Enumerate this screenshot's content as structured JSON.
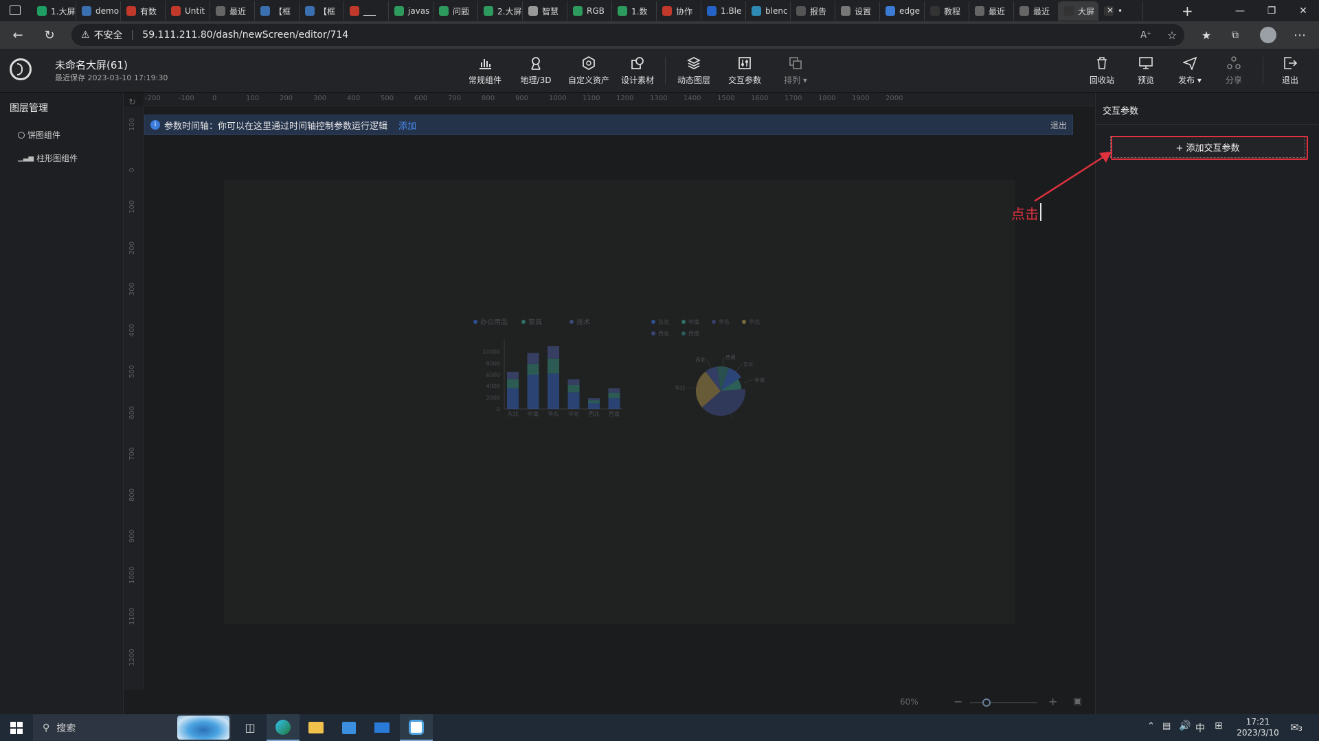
{
  "browser": {
    "tabs": [
      {
        "label": "1.大屏",
        "color": "#1e9e63"
      },
      {
        "label": "demo",
        "color": "#3a6fb0"
      },
      {
        "label": "有数",
        "color": "#c0392b"
      },
      {
        "label": "Untit",
        "color": "#c0392b"
      },
      {
        "label": "最近",
        "color": "#666666"
      },
      {
        "label": "【框",
        "color": "#3a6fb0"
      },
      {
        "label": "【框",
        "color": "#3a6fb0"
      },
      {
        "label": "___",
        "color": "#c0392b"
      },
      {
        "label": "javas",
        "color": "#2e9b5e"
      },
      {
        "label": "问题",
        "color": "#2e9b5e"
      },
      {
        "label": "2.大屏",
        "color": "#2e9b5e"
      },
      {
        "label": "智慧",
        "color": "#999999"
      },
      {
        "label": "RGB",
        "color": "#2e9b5e"
      },
      {
        "label": "1.数",
        "color": "#2e9b5e"
      },
      {
        "label": "协作",
        "color": "#c0392b"
      },
      {
        "label": "1.Ble",
        "color": "#2563c9"
      },
      {
        "label": "blenc",
        "color": "#2e8bb5"
      },
      {
        "label": "报告",
        "color": "#555555"
      },
      {
        "label": "设置",
        "color": "#777777"
      },
      {
        "label": "edge",
        "color": "#3b7bd4"
      },
      {
        "label": "教程",
        "color": "#333333"
      },
      {
        "label": "最近",
        "color": "#666666"
      },
      {
        "label": "最近",
        "color": "#666666"
      },
      {
        "label": "大屏",
        "color": "#333333"
      },
      {
        "label": "•",
        "color": "#333333"
      }
    ],
    "insecure_label": "不安全",
    "url": "59.111.211.80/dash/newScreen/editor/714"
  },
  "app": {
    "title": "未命名大屏(61)",
    "saved": "最近保存 2023-03-10 17:19:30",
    "toolbar": {
      "common": "常规组件",
      "geo": "地理/3D",
      "custom": "自定义资产",
      "design": "设计素材",
      "dynamic": "动态图层",
      "interactive": "交互参数",
      "arrange": "排列",
      "recycle": "回收站",
      "preview": "预览",
      "publish": "发布",
      "share": "分享",
      "exit": "退出"
    }
  },
  "left_panel": {
    "title": "图层管理",
    "layers": [
      "饼图组件",
      "柱形图组件"
    ]
  },
  "canvas": {
    "ruler_h": [
      "-200",
      "-100",
      "0",
      "100",
      "200",
      "300",
      "400",
      "500",
      "600",
      "700",
      "800",
      "900",
      "1000",
      "1100",
      "1200",
      "1300",
      "1400",
      "1500",
      "1600",
      "1700",
      "1800",
      "1900",
      "2000"
    ],
    "ruler_v": [
      "100",
      "0",
      "100",
      "200",
      "300",
      "400",
      "500",
      "600",
      "700",
      "800",
      "900",
      "1000",
      "1100",
      "1200"
    ],
    "timeline_text": "参数时间轴：你可以在这里通过时间轴控制参数运行逻辑",
    "timeline_add": "添加",
    "timeline_exit": "退出",
    "zoom": "60%"
  },
  "chart_data": [
    {
      "type": "bar",
      "categories": [
        "东北",
        "中南",
        "华东",
        "华北",
        "西北",
        "西南"
      ],
      "series": [
        {
          "name": "办公用品",
          "values": [
            3600,
            6000,
            6200,
            2900,
            1000,
            1900
          ]
        },
        {
          "name": "家具",
          "values": [
            1600,
            1800,
            2600,
            1300,
            500,
            900
          ]
        },
        {
          "name": "技术",
          "values": [
            1300,
            2000,
            2200,
            1000,
            400,
            800
          ]
        }
      ],
      "ylim": [
        0,
        12000
      ],
      "yticks": [
        "10000",
        "8000",
        "6000",
        "4000",
        "2000",
        "0"
      ],
      "colors": [
        "#2e4f8f",
        "#2f6f64",
        "#3d4a78"
      ]
    },
    {
      "type": "pie",
      "legend": [
        "东北",
        "中南",
        "华东",
        "华北",
        "西北",
        "西南"
      ],
      "slices": [
        {
          "label": "东北",
          "value": 10
        },
        {
          "label": "中南",
          "value": 8
        },
        {
          "label": "华东",
          "value": 40
        },
        {
          "label": "华北",
          "value": 26
        },
        {
          "label": "西北",
          "value": 8
        },
        {
          "label": "西南",
          "value": 8
        }
      ],
      "colors": [
        "#2e4f8f",
        "#2f6f64",
        "#36406a",
        "#7a6a3d",
        "#3a4576",
        "#2c5b5a"
      ]
    }
  ],
  "right_panel": {
    "title": "交互参数",
    "add_button": "+ 添加交互参数"
  },
  "annotation": {
    "text": "点击",
    "color": "#e0313f"
  },
  "taskbar": {
    "search": "搜索",
    "time": "17:21",
    "date": "2023/3/10",
    "ime": "中",
    "notifications": "3"
  }
}
